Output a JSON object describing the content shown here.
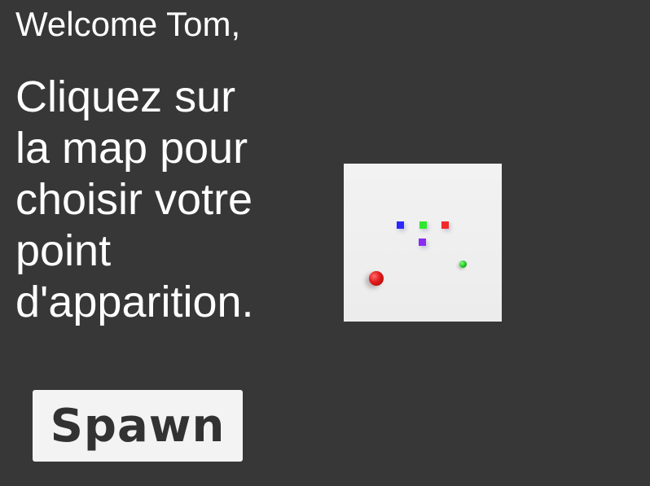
{
  "greeting": "Welcome Tom,",
  "instructions": {
    "lines": [
      "Cliquez sur",
      "la map pour",
      "choisir votre",
      "point",
      "d'apparition."
    ]
  },
  "spawn_button": {
    "label": "Spawn"
  },
  "map": {
    "background_color": "#efefef",
    "spawn_markers": [
      {
        "name": "blue",
        "color": "#2a28ff"
      },
      {
        "name": "green",
        "color": "#2ee82e"
      },
      {
        "name": "red",
        "color": "#f22a2a"
      },
      {
        "name": "purple",
        "color": "#8a2cf0"
      }
    ],
    "players": [
      {
        "name": "red-ball",
        "color": "#e21a1a"
      },
      {
        "name": "green-ball",
        "color": "#1fc31f"
      }
    ]
  },
  "colors": {
    "background": "#373737",
    "text": "#ffffff",
    "button_bg": "#f3f3f3",
    "button_text": "#323232"
  }
}
